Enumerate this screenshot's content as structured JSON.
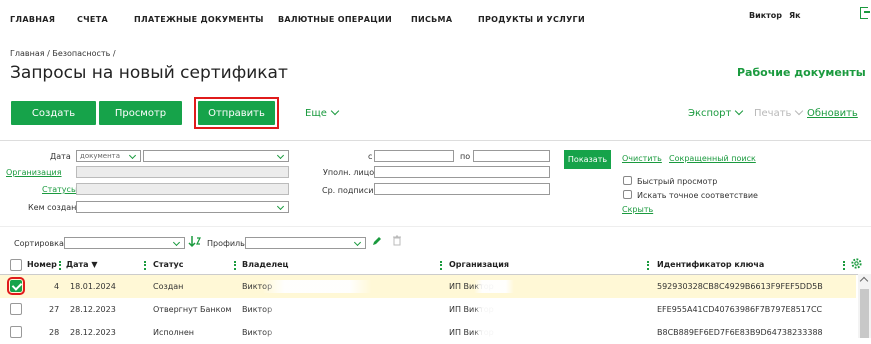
{
  "nav": {
    "items": [
      "ГЛАВНАЯ",
      "СЧЕТА",
      "ПЛАТЕЖНЫЕ ДОКУМЕНТЫ",
      "ВАЛЮТНЫЕ ОПЕРАЦИИ",
      "ПИСЬМА",
      "ПРОДУКТЫ И УСЛУГИ"
    ],
    "user_first": "Виктор",
    "user_last": "Як"
  },
  "breadcrumb": "Главная  /  Безопасность  /",
  "page_title": "Запросы на новый сертификат",
  "work_docs": "Рабочие документы",
  "toolbar": {
    "create": "Создать",
    "view": "Просмотр",
    "send": "Отправить",
    "more": "Еще",
    "export": "Экспорт",
    "print": "Печать",
    "refresh": "Обновить"
  },
  "filters": {
    "date_label": "Дата",
    "date_type_value": "документа",
    "org_label": "Организация",
    "statuses_label": "Статусы",
    "created_by_label": "Кем создан",
    "from_label": "с",
    "to_label": "по",
    "executor_label": "Уполн. лицо",
    "signatures_label": "Ср. подписи",
    "show_button": "Показать",
    "clear": "Очистить",
    "advanced_search": "Сокращенный поиск",
    "quick_view": "Быстрый просмотр",
    "exact_match": "Искать точное соответствие",
    "hide": "Скрыть"
  },
  "sort": {
    "sort_label": "Сортировка",
    "profile_label": "Профиль"
  },
  "table": {
    "columns": [
      "Номер",
      "Дата ▼",
      "Статус",
      "Владелец",
      "Организация",
      "Идентификатор ключа"
    ],
    "rows": [
      {
        "checked": true,
        "num": "4",
        "date": "18.01.2024",
        "status": "Создан",
        "owner": "Виктор",
        "org": "ИП Виктор",
        "key": "592930328CB8C4929B6613F9FEF5DD5B"
      },
      {
        "checked": false,
        "num": "27",
        "date": "28.12.2023",
        "status": "Отвергнут Банком",
        "owner": "Виктор",
        "org": "ИП Виктор",
        "key": "EFE955A41CD40763986F7B797E8517CC"
      },
      {
        "checked": false,
        "num": "28",
        "date": "28.12.2023",
        "status": "Исполнен",
        "owner": "Виктор",
        "org": "ИП Виктор",
        "key": "B8CB889EF6ED7F6E83B9D64738233388"
      }
    ]
  },
  "colors": {
    "accent": "#16a34a",
    "highlight": "#e01b1b",
    "selected_row": "#fff8d6"
  },
  "icons": [
    "logout-icon",
    "chevron-down-icon",
    "sort-direction-icon",
    "pencil-icon",
    "trash-icon",
    "gear-icon"
  ]
}
